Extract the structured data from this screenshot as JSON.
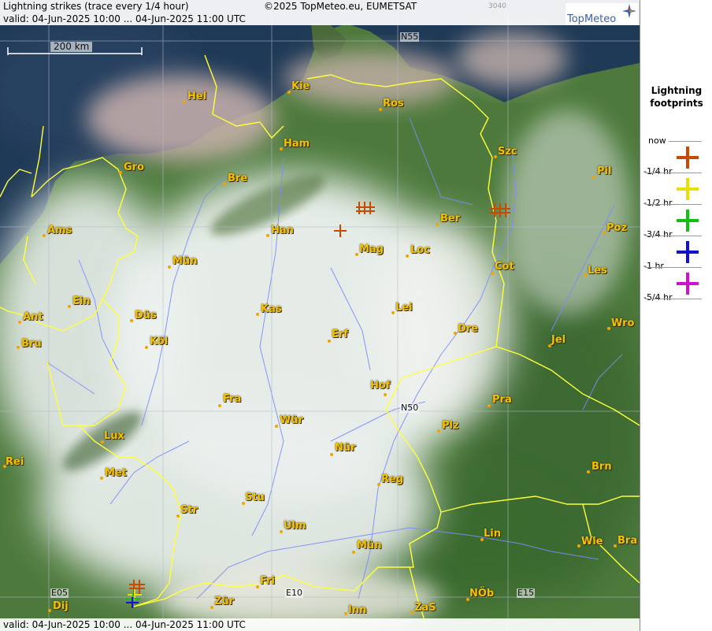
{
  "header": {
    "title": "Lightning strikes (trace every 1/4 hour)",
    "copyright": "©2025 TopMeteo.eu, EUMETSAT",
    "code": "3040",
    "valid_top": "valid:  04-Jun-2025 10:00 ... 04-Jun-2025 11:00 UTC",
    "valid_bottom": "valid:  04-Jun-2025 10:00 ... 04-Jun-2025 11:00 UTC",
    "brand": "TopMeteo"
  },
  "scale": {
    "label": "200 km"
  },
  "grid_labels": {
    "n55": "N55",
    "n50": "N50",
    "e05": "E05",
    "e10": "E10",
    "e15": "E15"
  },
  "cities": [
    "Hel",
    "Kie",
    "Ros",
    "Ham",
    "Szc",
    "Gro",
    "Bre",
    "Pil",
    "Ber",
    "Ams",
    "Han",
    "Poz",
    "Mag",
    "Loc",
    "Mün",
    "Cot",
    "Les",
    "Ein",
    "Kas",
    "Lei",
    "Ant",
    "Düs",
    "Wro",
    "Köl",
    "Erf",
    "Dre",
    "Bru",
    "Jel",
    "Hof",
    "Fra",
    "Pra",
    "Wür",
    "Plz",
    "Lux",
    "Nür",
    "Rei",
    "Met",
    "Reg",
    "Brn",
    "Stu",
    "Str",
    "Ulm",
    "Lin",
    "Mün",
    "Wie",
    "Bra",
    "Fri",
    "NÖb",
    "Dij",
    "Zür",
    "Inn",
    "ZaS"
  ],
  "legend": {
    "title_line1": "Lightning",
    "title_line2": "footprints",
    "entries": [
      {
        "label": "now",
        "color": "#c84a00"
      },
      {
        "label": "-1/4 hr",
        "color": "#e8e000"
      },
      {
        "label": "-1/2 hr",
        "color": "#10c010"
      },
      {
        "label": "-3/4 hr",
        "color": "#1010d0"
      },
      {
        "label": "-1 hr",
        "color": "#d010d0"
      },
      {
        "label": "-5/4 hr",
        "color": ""
      }
    ]
  },
  "colors": {
    "sea": "#1f3a56",
    "land": "#4d7a3c",
    "cloud": "#eef3f1",
    "border": "#ffff3a",
    "river": "#7a8cff",
    "city": "#f2c200",
    "strike_recent": "#c84a00"
  }
}
